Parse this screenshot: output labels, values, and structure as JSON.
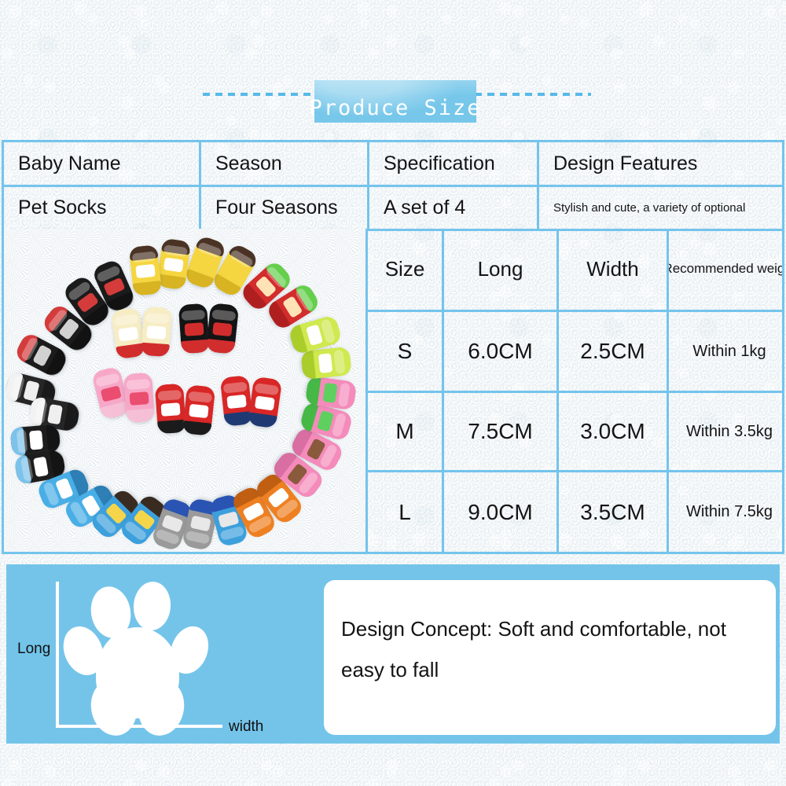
{
  "banner": {
    "title": "Produce Size"
  },
  "info_table": {
    "headers": [
      "Baby Name",
      "Season",
      "Specification",
      "Design Features"
    ],
    "values": [
      "Pet Socks",
      "Four Seasons",
      "A set of 4",
      "Stylish and cute, a variety of optional"
    ]
  },
  "size_table": {
    "headers": [
      "Size",
      "Long",
      "Width",
      "Recommended weight"
    ],
    "rows": [
      {
        "size": "S",
        "long": "6.0CM",
        "width": "2.5CM",
        "weight": "Within 1kg"
      },
      {
        "size": "M",
        "long": "7.5CM",
        "width": "3.0CM",
        "weight": "Within 3.5kg"
      },
      {
        "size": "L",
        "long": "9.0CM",
        "width": "3.5CM",
        "weight": "Within 7.5kg"
      }
    ]
  },
  "photo": {
    "alt": "pet socks assortment arranged in a circle on white fleece"
  },
  "bottom_panel": {
    "axis_long_label": "Long",
    "axis_width_label": "width",
    "concept_text": "Design Concept: Soft and comfortable, not easy to fall",
    "paw_icon": "paw-icon"
  },
  "colors": {
    "accent_blue": "#74c4ec",
    "panel_blue": "#74c4ea",
    "banner_blue": "#76c7ea",
    "text_dark": "#141414",
    "white": "#ffffff"
  }
}
